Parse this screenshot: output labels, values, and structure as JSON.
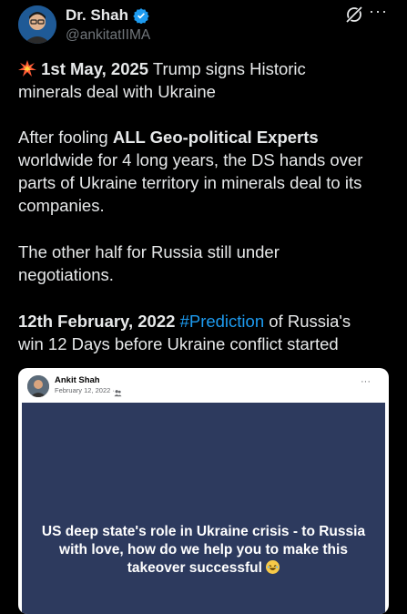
{
  "header": {
    "display_name": "Dr. Shah",
    "handle": "@ankitatIIMA",
    "verified_icon": "verified-badge-icon",
    "grok_icon": "grok-icon",
    "more_icon": "more-horizontal-icon"
  },
  "tweet": {
    "p1_date": "1st May, 2025",
    "p1_text_a": " Trump signs Historic",
    "p1_text_b": "minerals deal with Ukraine",
    "p2_a": "After fooling ",
    "p2_bold": "ALL Geo-political Experts",
    "p2_line2": "worldwide for 4 long years, the DS hands over",
    "p2_line3": "parts of Ukraine territory in minerals deal to its",
    "p2_line4": "companies.",
    "p3_line1": "The other half for Russia still under",
    "p3_line2": "negotiations.",
    "p4_date": "12th February, 2022",
    "p4_hashtag": "#Prediction",
    "p4_text_a": " of Russia's",
    "p4_line2": "win 12 Days before Ukraine conflict started"
  },
  "card": {
    "author": "Ankit Shah",
    "date": "February 12, 2022 ·",
    "more": "···",
    "banner_text": "US deep state's role in Ukraine crisis - to Russia with love, how do we help you to make this takeover successful"
  },
  "colors": {
    "background": "#000000",
    "text": "#e7e9ea",
    "muted": "#71767b",
    "link": "#1d9bf0",
    "banner": "#2d3a5e"
  }
}
